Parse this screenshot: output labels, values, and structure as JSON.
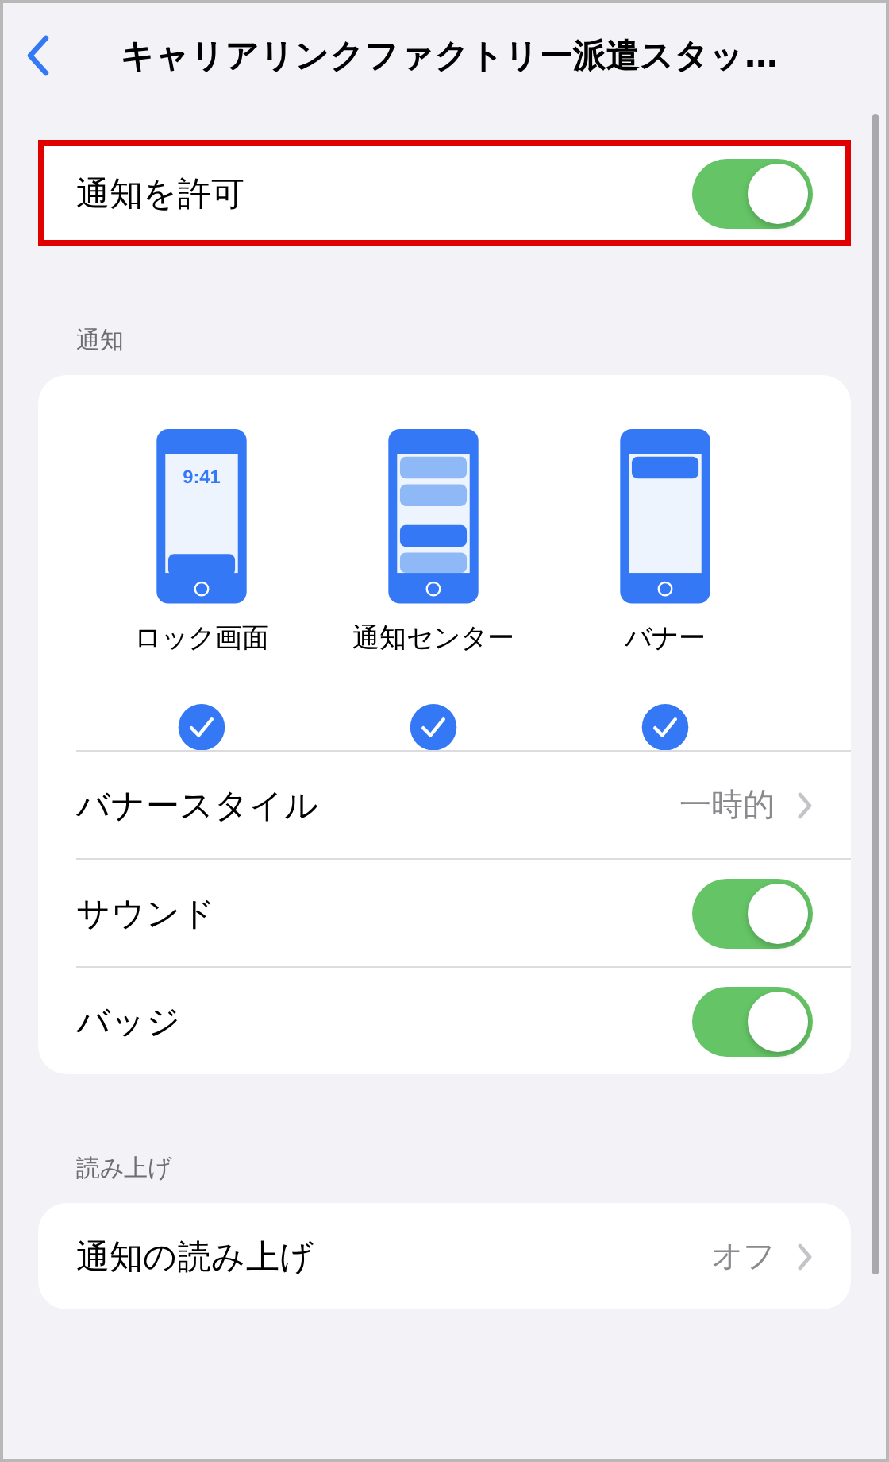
{
  "header": {
    "title": "キャリアリンクファクトリー派遣スタッ…"
  },
  "allow": {
    "label": "通知を許可",
    "on": true,
    "highlighted": true
  },
  "sections": [
    {
      "header": "通知",
      "styles": [
        {
          "kind": "lock",
          "label": "ロック画面",
          "clock": "9:41",
          "checked": true
        },
        {
          "kind": "center",
          "label": "通知センター",
          "checked": true
        },
        {
          "kind": "banner",
          "label": "バナー",
          "checked": true
        }
      ],
      "rows": [
        {
          "kind": "link",
          "label": "バナースタイル",
          "value": "一時的"
        },
        {
          "kind": "toggle",
          "label": "サウンド",
          "on": true
        },
        {
          "kind": "toggle",
          "label": "バッジ",
          "on": true
        }
      ]
    },
    {
      "header": "読み上げ",
      "rows": [
        {
          "kind": "link",
          "label": "通知の読み上げ",
          "value": "オフ"
        }
      ]
    }
  ]
}
